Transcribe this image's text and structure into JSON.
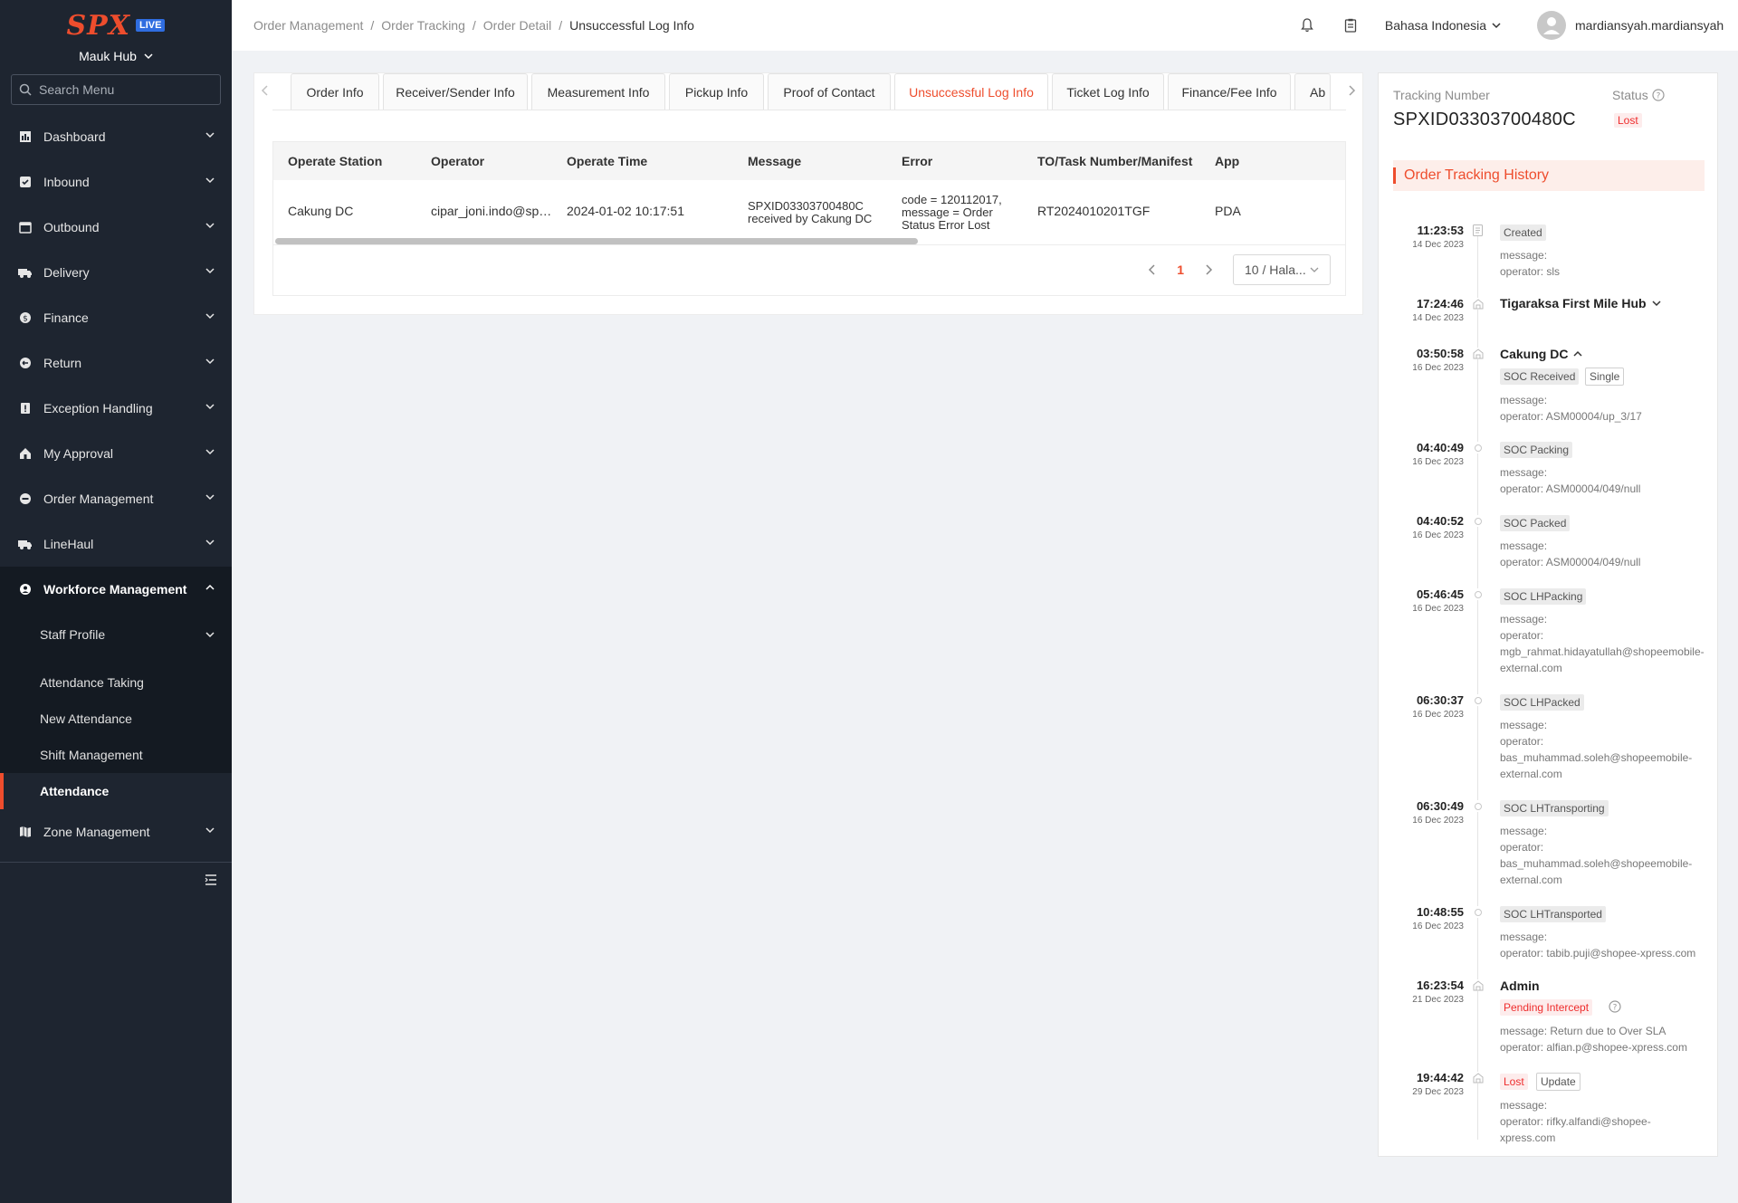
{
  "sidebar": {
    "logo_text": "SPX",
    "logo_badge": "LIVE",
    "hub": "Mauk Hub",
    "search_placeholder": "Search Menu",
    "items": [
      {
        "label": "Dashboard",
        "icon": "chart-icon"
      },
      {
        "label": "Inbound",
        "icon": "checkbox-icon"
      },
      {
        "label": "Outbound",
        "icon": "calendar-icon"
      },
      {
        "label": "Delivery",
        "icon": "truck-icon"
      },
      {
        "label": "Finance",
        "icon": "coin-icon"
      },
      {
        "label": "Return",
        "icon": "return-icon"
      },
      {
        "label": "Exception Handling",
        "icon": "alert-icon"
      },
      {
        "label": "My Approval",
        "icon": "home-icon"
      },
      {
        "label": "Order Management",
        "icon": "order-icon"
      },
      {
        "label": "LineHaul",
        "icon": "truck-icon"
      },
      {
        "label": "Workforce Management",
        "icon": "user-icon"
      },
      {
        "label": "Zone Management",
        "icon": "map-icon"
      }
    ],
    "workforce_sub": [
      "Staff Profile",
      "Attendance Taking",
      "New Attendance",
      "Shift Management",
      "Attendance"
    ]
  },
  "header": {
    "breadcrumb": [
      "Order Management",
      "Order Tracking",
      "Order Detail",
      "Unsuccessful Log Info"
    ],
    "language": "Bahasa Indonesia",
    "username": "mardiansyah.mardiansyah"
  },
  "tabs": [
    "Order Info",
    "Receiver/Sender Info",
    "Measurement Info",
    "Pickup Info",
    "Proof of Contact",
    "Unsuccessful Log Info",
    "Ticket Log Info",
    "Finance/Fee Info",
    "Ab"
  ],
  "table": {
    "columns": [
      "Operate Station",
      "Operator",
      "Operate Time",
      "Message",
      "Error",
      "TO/Task Number/Manifest",
      "App"
    ],
    "rows": [
      {
        "station": "Cakung DC",
        "operator": "cipar_joni.indo@spx...",
        "time": "2024-01-02 10:17:51",
        "message": "SPXID03303700480C received by Cakung DC",
        "error": "code = 120112017, message = Order Status Error Lost",
        "manifest": "RT2024010201TGF",
        "app": "PDA"
      }
    ]
  },
  "pagination": {
    "current": "1",
    "page_size": "10 / Hala..."
  },
  "tracking": {
    "number_label": "Tracking Number",
    "number": "SPXID03303700480C",
    "status_label": "Status",
    "status": "Lost",
    "history_title": "Order Tracking History",
    "events": [
      {
        "time": "11:23:53",
        "date": "14 Dec 2023",
        "tag": "Created",
        "msg1": "message:",
        "msg2": "operator: sls"
      },
      {
        "time": "17:24:46",
        "date": "14 Dec 2023",
        "title": "Tigaraksa First Mile Hub"
      },
      {
        "time": "03:50:58",
        "date": "16 Dec 2023",
        "title": "Cakung DC",
        "tag": "SOC Received",
        "tag2": "Single",
        "msg1": "message:",
        "msg2": "operator: ASM00004/up_3/17"
      },
      {
        "time": "04:40:49",
        "date": "16 Dec 2023",
        "tag": "SOC Packing",
        "msg1": "message:",
        "msg2": "operator: ASM00004/049/null"
      },
      {
        "time": "04:40:52",
        "date": "16 Dec 2023",
        "tag": "SOC Packed",
        "msg1": "message:",
        "msg2": "operator: ASM00004/049/null"
      },
      {
        "time": "05:46:45",
        "date": "16 Dec 2023",
        "tag": "SOC LHPacking",
        "msg1": "message:",
        "msg2": "operator: mgb_rahmat.hidayatullah@shopeemobile-external.com"
      },
      {
        "time": "06:30:37",
        "date": "16 Dec 2023",
        "tag": "SOC LHPacked",
        "msg1": "message:",
        "msg2": "operator: bas_muhammad.soleh@shopeemobile-external.com"
      },
      {
        "time": "06:30:49",
        "date": "16 Dec 2023",
        "tag": "SOC LHTransporting",
        "msg1": "message:",
        "msg2": "operator: bas_muhammad.soleh@shopeemobile-external.com"
      },
      {
        "time": "10:48:55",
        "date": "16 Dec 2023",
        "tag": "SOC LHTransported",
        "msg1": "message:",
        "msg2": "operator: tabib.puji@shopee-xpress.com"
      },
      {
        "time": "16:23:54",
        "date": "21 Dec 2023",
        "title": "Admin",
        "tag": "Pending Intercept",
        "msg1": "message: Return due to Over SLA",
        "msg2": "operator: alfian.p@shopee-xpress.com"
      },
      {
        "time": "19:44:42",
        "date": "29 Dec 2023",
        "tag": "Lost",
        "tag2": "Update",
        "msg1": "message:",
        "msg2": "operator: rifky.alfandi@shopee-xpress.com"
      }
    ]
  },
  "colors": {
    "accent": "#ee4d2d",
    "sidebar_bg": "#1e2530"
  }
}
